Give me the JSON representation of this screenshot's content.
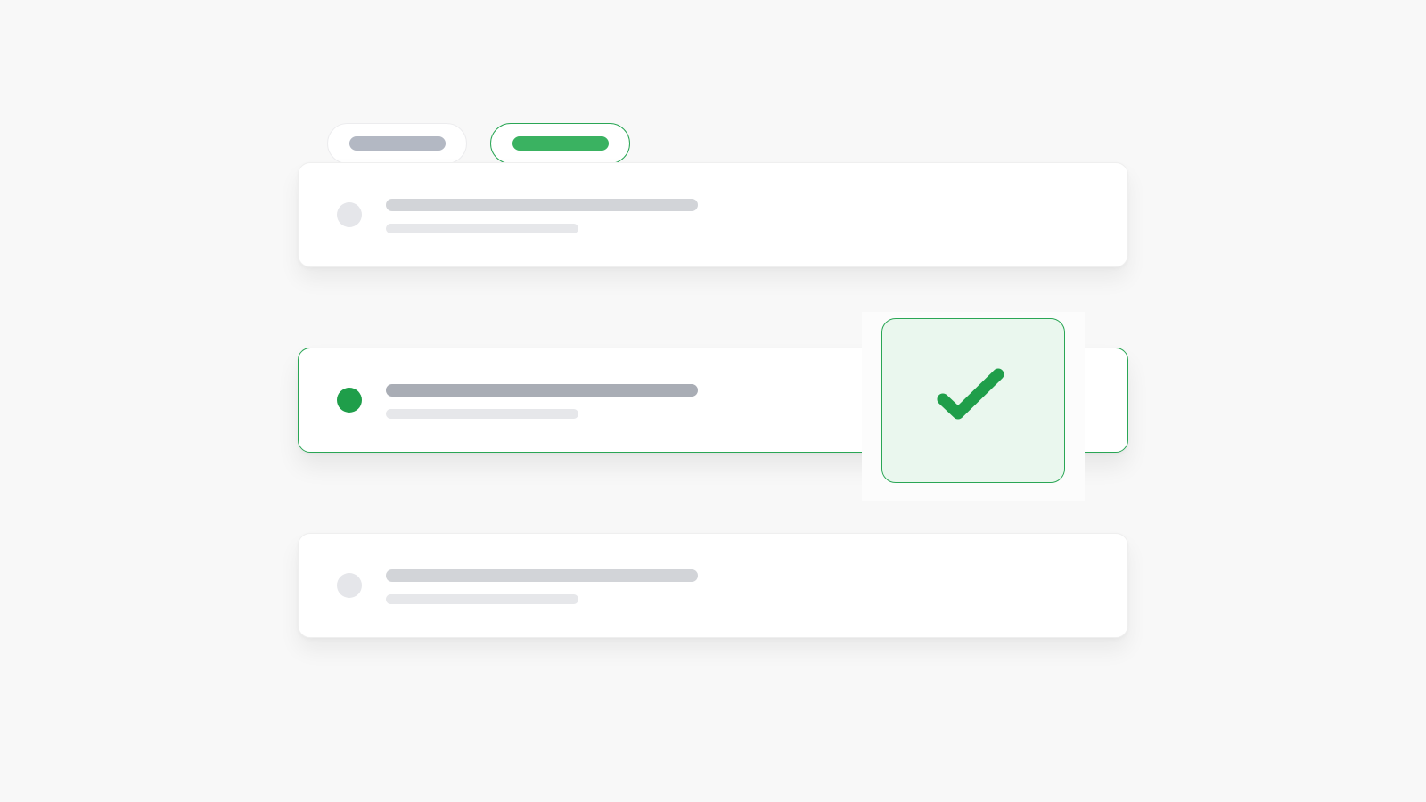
{
  "tabs": [
    {
      "state": "inactive",
      "color": "#b3b8c3"
    },
    {
      "state": "active",
      "color": "#3ab261"
    }
  ],
  "options": [
    {
      "selected": false
    },
    {
      "selected": true
    },
    {
      "selected": false
    }
  ],
  "confirmation": {
    "icon": "checkmark-icon",
    "accent_color": "#1f9e4a",
    "background_color": "#eaf7ee"
  },
  "colors": {
    "accent": "#2aa655",
    "page_background": "#f8f8f8",
    "placeholder": "#d2d4d8"
  }
}
